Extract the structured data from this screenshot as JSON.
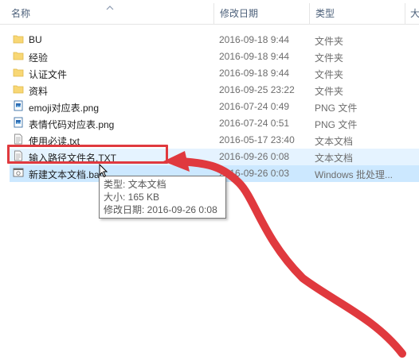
{
  "header": {
    "col_name": "名称",
    "col_date": "修改日期",
    "col_type": "类型",
    "col_size": "大"
  },
  "files": [
    {
      "name": "BU",
      "date": "2016-09-18 9:44",
      "type": "文件夹",
      "icon": "folder-icon"
    },
    {
      "name": "经验",
      "date": "2016-09-18 9:44",
      "type": "文件夹",
      "icon": "folder-icon"
    },
    {
      "name": "认证文件",
      "date": "2016-09-18 9:44",
      "type": "文件夹",
      "icon": "folder-icon"
    },
    {
      "name": "资料",
      "date": "2016-09-25 23:22",
      "type": "文件夹",
      "icon": "folder-icon"
    },
    {
      "name": "emoji对应表.png",
      "date": "2016-07-24 0:49",
      "type": "PNG 文件",
      "icon": "image-file-icon"
    },
    {
      "name": "表情代码对应表.png",
      "date": "2016-07-24 0:51",
      "type": "PNG 文件",
      "icon": "image-file-icon"
    },
    {
      "name": "使用必读.txt",
      "date": "2016-05-17 23:40",
      "type": "文本文档",
      "icon": "text-file-icon"
    },
    {
      "name": "输入路径文件名.TXT",
      "date": "2016-09-26 0:08",
      "type": "文本文档",
      "icon": "text-file-icon"
    },
    {
      "name": "新建文本文档.bat",
      "date": "2016-09-26 0:03",
      "type": "Windows 批处理...",
      "icon": "batch-file-icon"
    }
  ],
  "tooltip": {
    "type_line": "类型: 文本文档",
    "size_line": "大小: 165 KB",
    "date_line": "修改日期: 2016-09-26 0:08"
  },
  "colors": {
    "selection": "#cce8ff",
    "hover": "#e5f3ff",
    "annotation_red": "#e0393e",
    "folder": "#f8d775"
  }
}
